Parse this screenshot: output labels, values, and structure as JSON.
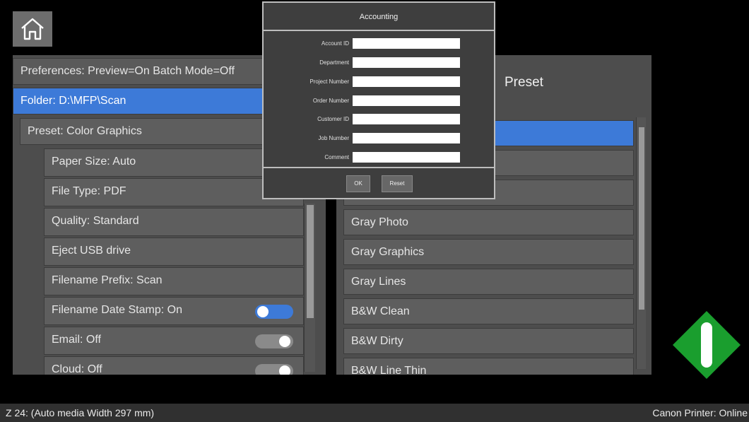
{
  "left_panel": {
    "preferences": "Preferences: Preview=On Batch Mode=Off",
    "folder": "Folder: D:\\MFP\\Scan",
    "preset": "Preset: Color Graphics",
    "settings": [
      {
        "label": "Paper Size: Auto"
      },
      {
        "label": "File Type: PDF"
      },
      {
        "label": "Quality: Standard"
      },
      {
        "label": "Eject USB drive"
      },
      {
        "label": "Filename Prefix: Scan"
      },
      {
        "label": "Filename Date Stamp: On",
        "toggle": "on"
      },
      {
        "label": "Email: Off",
        "toggle": "off"
      },
      {
        "label": "Cloud: Off",
        "toggle": "off"
      }
    ]
  },
  "right_panel": {
    "title": "Preset",
    "items": [
      "",
      "",
      "",
      "Gray Photo",
      "Gray Graphics",
      "Gray Lines",
      "B&W Clean",
      "B&W Dirty",
      "B&W Line Thin"
    ]
  },
  "dialog": {
    "title": "Accounting",
    "fields": [
      {
        "label": "Account ID",
        "value": ""
      },
      {
        "label": "Department",
        "value": ""
      },
      {
        "label": "Project Number",
        "value": ""
      },
      {
        "label": "Order Number",
        "value": ""
      },
      {
        "label": "Customer ID",
        "value": ""
      },
      {
        "label": "Job Number",
        "value": ""
      },
      {
        "label": "Comment",
        "value": ""
      }
    ],
    "ok_label": "OK",
    "reset_label": "Reset"
  },
  "status": {
    "left": "Z 24: (Auto media Width 297 mm)",
    "right": "Canon Printer: Online"
  },
  "colors": {
    "accent": "#3d7ad8",
    "go": "#1a9e2e"
  },
  "icons": {
    "home": "home-icon",
    "go": "start-scan-icon"
  }
}
